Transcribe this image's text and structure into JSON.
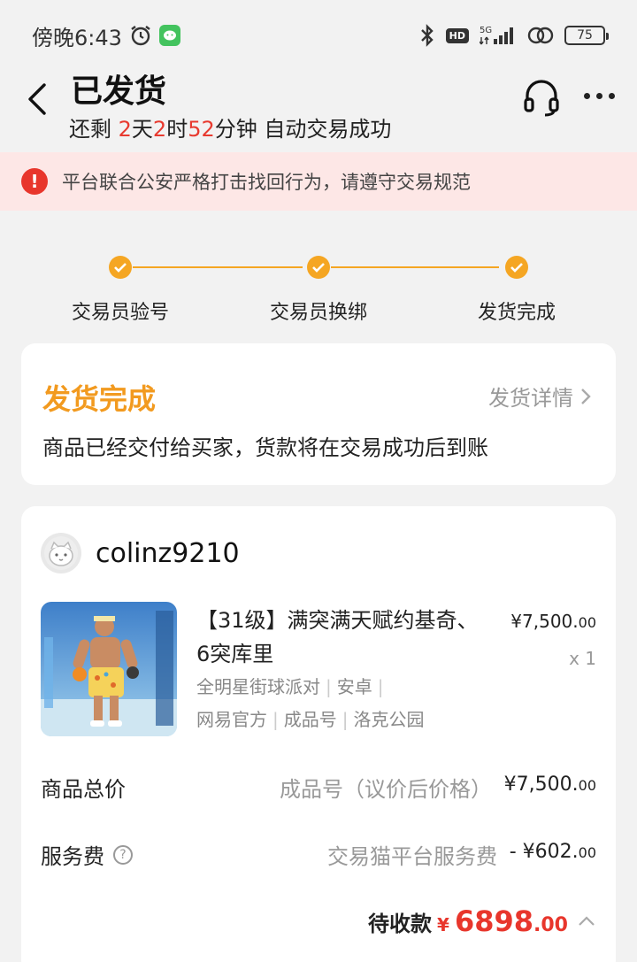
{
  "status_bar": {
    "time": "傍晚6:43",
    "network": "5G",
    "battery": "75"
  },
  "header": {
    "title": "已发货",
    "countdown": {
      "prefix": "还剩 ",
      "days": "2",
      "days_unit": "天",
      "hours": "2",
      "hours_unit": "时",
      "minutes": "52",
      "minutes_unit": "分钟 自动交易成功"
    }
  },
  "notice": {
    "text": "平台联合公安严格打击找回行为，请遵守交易规范"
  },
  "steps": [
    {
      "label": "交易员验号"
    },
    {
      "label": "交易员换绑"
    },
    {
      "label": "发货完成"
    }
  ],
  "delivery_card": {
    "title": "发货完成",
    "detail_link": "发货详情",
    "description": "商品已经交付给买家，货款将在交易成功后到账"
  },
  "order_card": {
    "seller": "colinz9210",
    "product": {
      "title": "【31级】满突满天赋约基奇、6突库里",
      "meta_line1": [
        "全明星街球派对",
        "安卓"
      ],
      "meta_line2": [
        "网易官方",
        "成品号",
        "洛克公园"
      ],
      "price_int": "¥7,500.",
      "price_dec": "00",
      "quantity": "x 1"
    },
    "total_price": {
      "label": "商品总价",
      "note": "成品号（议价后价格）",
      "amount_int": "¥7,500.",
      "amount_dec": "00"
    },
    "service_fee": {
      "label": "服务费",
      "note": "交易猫平台服务费",
      "amount_int": "- ¥602.",
      "amount_dec": "00"
    },
    "receivable": {
      "label": "待收款",
      "currency": "¥",
      "amount_int": "6898",
      "amount_dec": ".00"
    }
  },
  "colors": {
    "accent_orange": "#f5a623",
    "alert_red": "#e8362c",
    "notice_bg": "#fde7e6"
  }
}
